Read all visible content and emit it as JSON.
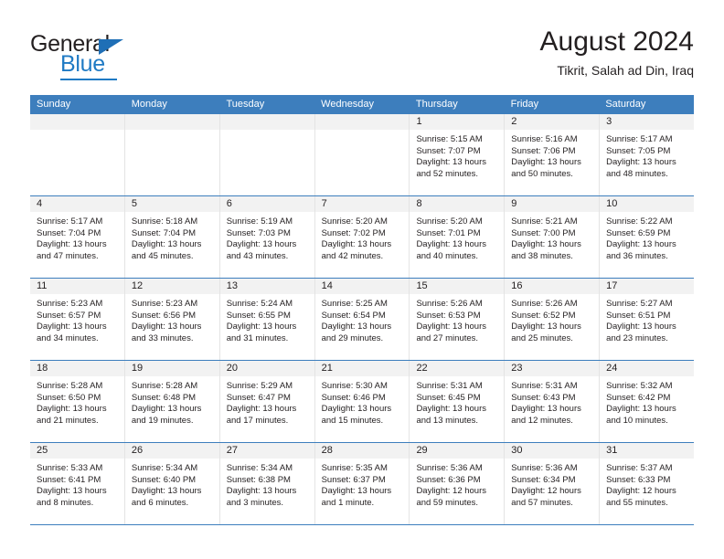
{
  "brand": {
    "name_part1": "General",
    "name_part2": "Blue",
    "triangle_color": "#1f6fb6",
    "blue_color": "#1f7ac4"
  },
  "header": {
    "month_title": "August 2024",
    "location": "Tikrit, Salah ad Din, Iraq",
    "header_bg": "#3d7ebd",
    "day_strip_bg": "#f2f2f2"
  },
  "calendar": {
    "weekday_headers": [
      "Sunday",
      "Monday",
      "Tuesday",
      "Wednesday",
      "Thursday",
      "Friday",
      "Saturday"
    ],
    "weeks": [
      [
        {
          "day": "",
          "empty": true
        },
        {
          "day": "",
          "empty": true
        },
        {
          "day": "",
          "empty": true
        },
        {
          "day": "",
          "empty": true
        },
        {
          "day": "1",
          "sunrise": "Sunrise: 5:15 AM",
          "sunset": "Sunset: 7:07 PM",
          "daylight1": "Daylight: 13 hours",
          "daylight2": "and 52 minutes."
        },
        {
          "day": "2",
          "sunrise": "Sunrise: 5:16 AM",
          "sunset": "Sunset: 7:06 PM",
          "daylight1": "Daylight: 13 hours",
          "daylight2": "and 50 minutes."
        },
        {
          "day": "3",
          "sunrise": "Sunrise: 5:17 AM",
          "sunset": "Sunset: 7:05 PM",
          "daylight1": "Daylight: 13 hours",
          "daylight2": "and 48 minutes."
        }
      ],
      [
        {
          "day": "4",
          "sunrise": "Sunrise: 5:17 AM",
          "sunset": "Sunset: 7:04 PM",
          "daylight1": "Daylight: 13 hours",
          "daylight2": "and 47 minutes."
        },
        {
          "day": "5",
          "sunrise": "Sunrise: 5:18 AM",
          "sunset": "Sunset: 7:04 PM",
          "daylight1": "Daylight: 13 hours",
          "daylight2": "and 45 minutes."
        },
        {
          "day": "6",
          "sunrise": "Sunrise: 5:19 AM",
          "sunset": "Sunset: 7:03 PM",
          "daylight1": "Daylight: 13 hours",
          "daylight2": "and 43 minutes."
        },
        {
          "day": "7",
          "sunrise": "Sunrise: 5:20 AM",
          "sunset": "Sunset: 7:02 PM",
          "daylight1": "Daylight: 13 hours",
          "daylight2": "and 42 minutes."
        },
        {
          "day": "8",
          "sunrise": "Sunrise: 5:20 AM",
          "sunset": "Sunset: 7:01 PM",
          "daylight1": "Daylight: 13 hours",
          "daylight2": "and 40 minutes."
        },
        {
          "day": "9",
          "sunrise": "Sunrise: 5:21 AM",
          "sunset": "Sunset: 7:00 PM",
          "daylight1": "Daylight: 13 hours",
          "daylight2": "and 38 minutes."
        },
        {
          "day": "10",
          "sunrise": "Sunrise: 5:22 AM",
          "sunset": "Sunset: 6:59 PM",
          "daylight1": "Daylight: 13 hours",
          "daylight2": "and 36 minutes."
        }
      ],
      [
        {
          "day": "11",
          "sunrise": "Sunrise: 5:23 AM",
          "sunset": "Sunset: 6:57 PM",
          "daylight1": "Daylight: 13 hours",
          "daylight2": "and 34 minutes."
        },
        {
          "day": "12",
          "sunrise": "Sunrise: 5:23 AM",
          "sunset": "Sunset: 6:56 PM",
          "daylight1": "Daylight: 13 hours",
          "daylight2": "and 33 minutes."
        },
        {
          "day": "13",
          "sunrise": "Sunrise: 5:24 AM",
          "sunset": "Sunset: 6:55 PM",
          "daylight1": "Daylight: 13 hours",
          "daylight2": "and 31 minutes."
        },
        {
          "day": "14",
          "sunrise": "Sunrise: 5:25 AM",
          "sunset": "Sunset: 6:54 PM",
          "daylight1": "Daylight: 13 hours",
          "daylight2": "and 29 minutes."
        },
        {
          "day": "15",
          "sunrise": "Sunrise: 5:26 AM",
          "sunset": "Sunset: 6:53 PM",
          "daylight1": "Daylight: 13 hours",
          "daylight2": "and 27 minutes."
        },
        {
          "day": "16",
          "sunrise": "Sunrise: 5:26 AM",
          "sunset": "Sunset: 6:52 PM",
          "daylight1": "Daylight: 13 hours",
          "daylight2": "and 25 minutes."
        },
        {
          "day": "17",
          "sunrise": "Sunrise: 5:27 AM",
          "sunset": "Sunset: 6:51 PM",
          "daylight1": "Daylight: 13 hours",
          "daylight2": "and 23 minutes."
        }
      ],
      [
        {
          "day": "18",
          "sunrise": "Sunrise: 5:28 AM",
          "sunset": "Sunset: 6:50 PM",
          "daylight1": "Daylight: 13 hours",
          "daylight2": "and 21 minutes."
        },
        {
          "day": "19",
          "sunrise": "Sunrise: 5:28 AM",
          "sunset": "Sunset: 6:48 PM",
          "daylight1": "Daylight: 13 hours",
          "daylight2": "and 19 minutes."
        },
        {
          "day": "20",
          "sunrise": "Sunrise: 5:29 AM",
          "sunset": "Sunset: 6:47 PM",
          "daylight1": "Daylight: 13 hours",
          "daylight2": "and 17 minutes."
        },
        {
          "day": "21",
          "sunrise": "Sunrise: 5:30 AM",
          "sunset": "Sunset: 6:46 PM",
          "daylight1": "Daylight: 13 hours",
          "daylight2": "and 15 minutes."
        },
        {
          "day": "22",
          "sunrise": "Sunrise: 5:31 AM",
          "sunset": "Sunset: 6:45 PM",
          "daylight1": "Daylight: 13 hours",
          "daylight2": "and 13 minutes."
        },
        {
          "day": "23",
          "sunrise": "Sunrise: 5:31 AM",
          "sunset": "Sunset: 6:43 PM",
          "daylight1": "Daylight: 13 hours",
          "daylight2": "and 12 minutes."
        },
        {
          "day": "24",
          "sunrise": "Sunrise: 5:32 AM",
          "sunset": "Sunset: 6:42 PM",
          "daylight1": "Daylight: 13 hours",
          "daylight2": "and 10 minutes."
        }
      ],
      [
        {
          "day": "25",
          "sunrise": "Sunrise: 5:33 AM",
          "sunset": "Sunset: 6:41 PM",
          "daylight1": "Daylight: 13 hours",
          "daylight2": "and 8 minutes."
        },
        {
          "day": "26",
          "sunrise": "Sunrise: 5:34 AM",
          "sunset": "Sunset: 6:40 PM",
          "daylight1": "Daylight: 13 hours",
          "daylight2": "and 6 minutes."
        },
        {
          "day": "27",
          "sunrise": "Sunrise: 5:34 AM",
          "sunset": "Sunset: 6:38 PM",
          "daylight1": "Daylight: 13 hours",
          "daylight2": "and 3 minutes."
        },
        {
          "day": "28",
          "sunrise": "Sunrise: 5:35 AM",
          "sunset": "Sunset: 6:37 PM",
          "daylight1": "Daylight: 13 hours",
          "daylight2": "and 1 minute."
        },
        {
          "day": "29",
          "sunrise": "Sunrise: 5:36 AM",
          "sunset": "Sunset: 6:36 PM",
          "daylight1": "Daylight: 12 hours",
          "daylight2": "and 59 minutes."
        },
        {
          "day": "30",
          "sunrise": "Sunrise: 5:36 AM",
          "sunset": "Sunset: 6:34 PM",
          "daylight1": "Daylight: 12 hours",
          "daylight2": "and 57 minutes."
        },
        {
          "day": "31",
          "sunrise": "Sunrise: 5:37 AM",
          "sunset": "Sunset: 6:33 PM",
          "daylight1": "Daylight: 12 hours",
          "daylight2": "and 55 minutes."
        }
      ]
    ]
  }
}
